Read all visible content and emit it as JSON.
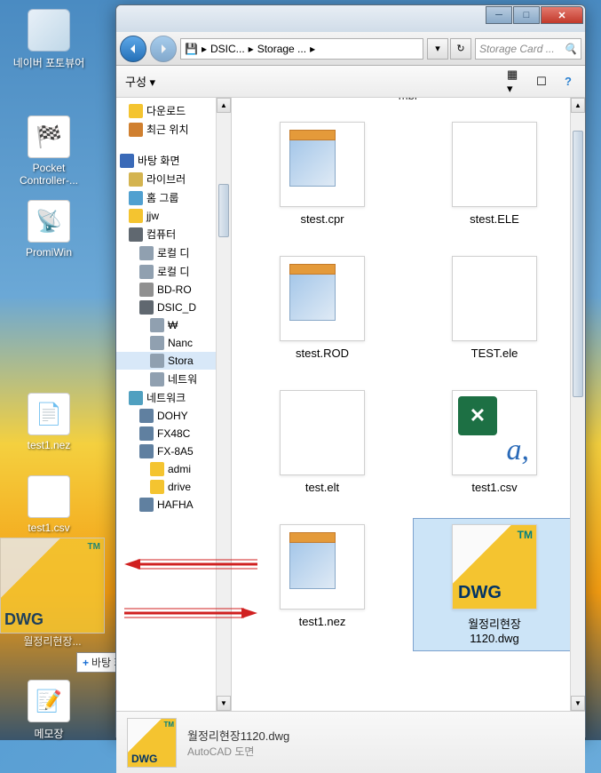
{
  "desktop": {
    "icons": [
      {
        "label": "네이버\n포토뷰어"
      },
      {
        "label": "Pocket\nController-..."
      },
      {
        "label": "PromiWin"
      },
      {
        "label": "test1.nez"
      },
      {
        "label": "test1.csv"
      },
      {
        "label": "메모장"
      }
    ],
    "drag_label": "월정리현장...",
    "drag_badge": "DWG"
  },
  "drag_tooltip": "바탕 화면(으)로 복사",
  "window": {
    "breadcrumb": {
      "seg1": "DSIC...",
      "seg2": "Storage ..."
    },
    "search_placeholder": "Storage Card ...",
    "toolbar": {
      "organize": "구성 ▾"
    },
    "tree": [
      {
        "label": "다운로드",
        "indent": 1,
        "color": "#f4c430"
      },
      {
        "label": "최근 위치",
        "indent": 1,
        "color": "#d08030"
      },
      {
        "label": "바탕 화면",
        "indent": 0,
        "color": "#3a6ab8"
      },
      {
        "label": "라이브러",
        "indent": 1,
        "color": "#d4b450"
      },
      {
        "label": "홈 그룹",
        "indent": 1,
        "color": "#50a0d0"
      },
      {
        "label": "jjw",
        "indent": 1,
        "color": "#f4c430"
      },
      {
        "label": "컴퓨터",
        "indent": 1,
        "color": "#606870"
      },
      {
        "label": "로컬 디",
        "indent": 2,
        "color": "#90a0b0"
      },
      {
        "label": "로컬 디",
        "indent": 2,
        "color": "#90a0b0"
      },
      {
        "label": "BD-RO",
        "indent": 2,
        "color": "#909090"
      },
      {
        "label": "DSIC_D",
        "indent": 2,
        "color": "#606870"
      },
      {
        "label": "₩",
        "indent": 3,
        "color": "#90a0b0"
      },
      {
        "label": "Nanc",
        "indent": 3,
        "color": "#90a0b0"
      },
      {
        "label": "Stora",
        "indent": 3,
        "color": "#90a0b0",
        "sel": true
      },
      {
        "label": "네트워",
        "indent": 3,
        "color": "#90a0b0"
      },
      {
        "label": "네트워크",
        "indent": 1,
        "color": "#50a0c0"
      },
      {
        "label": "DOHY",
        "indent": 2,
        "color": "#6080a0"
      },
      {
        "label": "FX48C",
        "indent": 2,
        "color": "#6080a0"
      },
      {
        "label": "FX-8A5",
        "indent": 2,
        "color": "#6080a0"
      },
      {
        "label": "admi",
        "indent": 3,
        "color": "#f4c430"
      },
      {
        "label": "drive",
        "indent": 3,
        "color": "#f4c430"
      },
      {
        "label": "HAFHA",
        "indent": 2,
        "color": "#6080a0"
      }
    ],
    "mbr": "mbr",
    "files": [
      {
        "name": "stest.cpr",
        "kind": "notepad"
      },
      {
        "name": "stest.ELE",
        "kind": "blank"
      },
      {
        "name": "stest.ROD",
        "kind": "notepad"
      },
      {
        "name": "TEST.ele",
        "kind": "blank"
      },
      {
        "name": "test.elt",
        "kind": "blank"
      },
      {
        "name": "test1.csv",
        "kind": "excel"
      },
      {
        "name": "test1.nez",
        "kind": "notepad"
      },
      {
        "name": "월정리현장\n1120.dwg",
        "kind": "dwg",
        "sel": true
      }
    ],
    "detail": {
      "name": "월정리현장1120.dwg",
      "type": "AutoCAD 도면"
    }
  }
}
